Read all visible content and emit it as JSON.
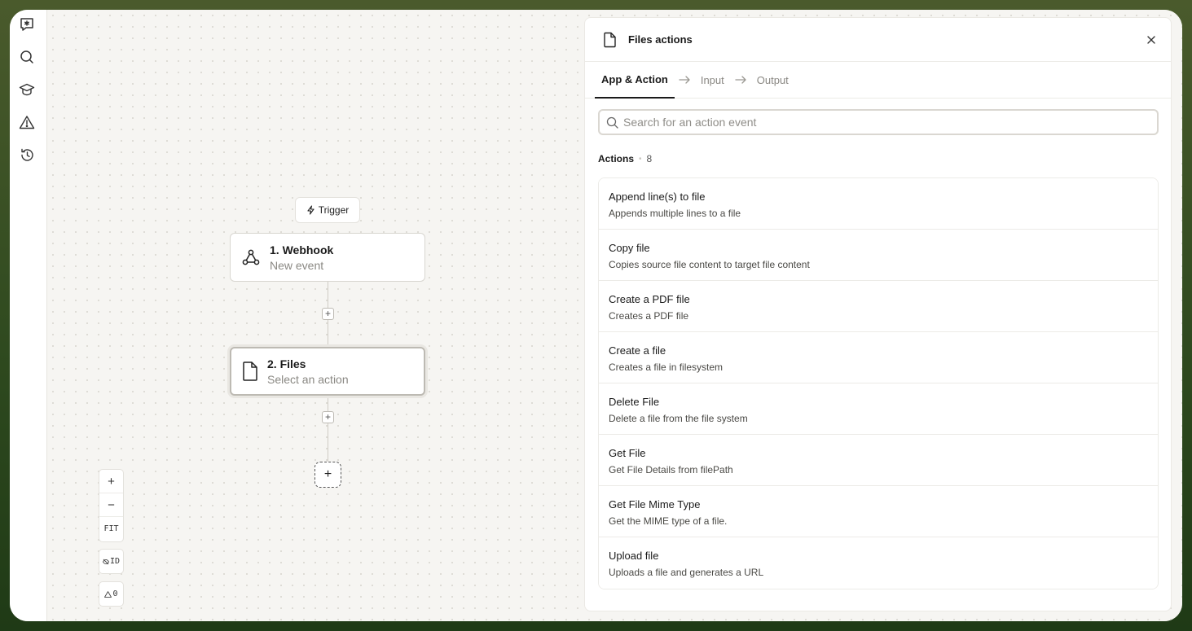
{
  "rail": {
    "icons": [
      "chat-asterisk-icon",
      "search-icon",
      "graduation-cap-icon",
      "warning-icon",
      "history-icon"
    ]
  },
  "canvas": {
    "trigger_chip": "Trigger",
    "nodes": [
      {
        "title": "1. Webhook",
        "subtitle": "New event",
        "icon": "webhook-icon"
      },
      {
        "title": "2. Files",
        "subtitle": "Select an action",
        "icon": "file-icon"
      }
    ],
    "zoom": {
      "in": "+",
      "out": "−",
      "fit": "FIT"
    },
    "id_toggle": "ID",
    "warnings": "0"
  },
  "panel": {
    "title": "Files actions",
    "tabs": [
      {
        "label": "App & Action",
        "active": true
      },
      {
        "label": "Input",
        "active": false
      },
      {
        "label": "Output",
        "active": false
      }
    ],
    "search_placeholder": "Search for an action event",
    "actions_label": "Actions",
    "actions_count": "8",
    "actions": [
      {
        "name": "Append line(s) to file",
        "desc": "Appends multiple lines to a file"
      },
      {
        "name": "Copy file",
        "desc": "Copies source file content to target file content"
      },
      {
        "name": "Create a PDF file",
        "desc": "Creates a PDF file"
      },
      {
        "name": "Create a file",
        "desc": "Creates a file in filesystem"
      },
      {
        "name": "Delete File",
        "desc": "Delete a file from the file system"
      },
      {
        "name": "Get File",
        "desc": "Get File Details from filePath"
      },
      {
        "name": "Get File Mime Type",
        "desc": "Get the MIME type of a file."
      },
      {
        "name": "Upload file",
        "desc": "Uploads a file and generates a URL"
      }
    ]
  }
}
